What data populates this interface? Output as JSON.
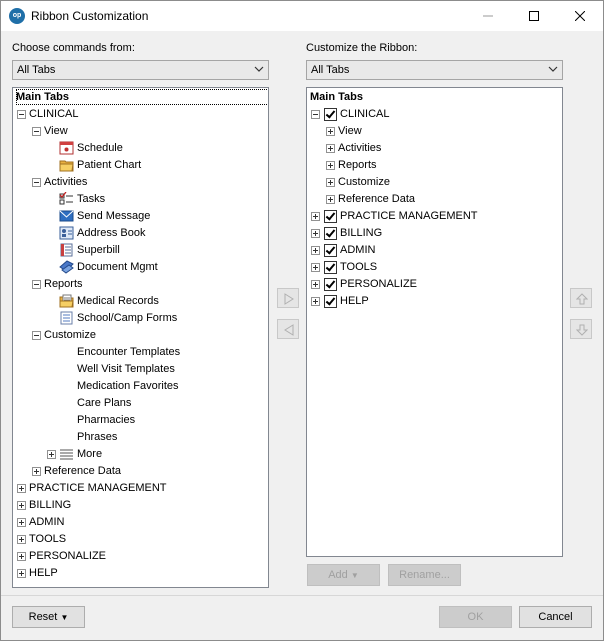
{
  "window": {
    "title": "Ribbon Customization",
    "app_icon": "op"
  },
  "left": {
    "label": "Choose commands from:",
    "combo_value": "All Tabs",
    "items": [
      {
        "label": "Main Tabs"
      },
      {
        "label": "CLINICAL"
      },
      {
        "label": "View"
      },
      {
        "label": "Schedule"
      },
      {
        "label": "Patient Chart"
      },
      {
        "label": "Activities"
      },
      {
        "label": "Tasks"
      },
      {
        "label": "Send Message"
      },
      {
        "label": "Address Book"
      },
      {
        "label": "Superbill"
      },
      {
        "label": "Document Mgmt"
      },
      {
        "label": "Reports"
      },
      {
        "label": "Medical Records"
      },
      {
        "label": "School/Camp Forms"
      },
      {
        "label": "Customize"
      },
      {
        "label": "Encounter Templates"
      },
      {
        "label": "Well Visit Templates"
      },
      {
        "label": "Medication Favorites"
      },
      {
        "label": "Care Plans"
      },
      {
        "label": "Pharmacies"
      },
      {
        "label": "Phrases"
      },
      {
        "label": "More"
      },
      {
        "label": "Reference Data"
      },
      {
        "label": "PRACTICE MANAGEMENT"
      },
      {
        "label": "BILLING"
      },
      {
        "label": "ADMIN"
      },
      {
        "label": "TOOLS"
      },
      {
        "label": "PERSONALIZE"
      },
      {
        "label": "HELP"
      }
    ]
  },
  "right": {
    "label": "Customize the Ribbon:",
    "combo_value": "All Tabs",
    "items": [
      {
        "label": "Main Tabs"
      },
      {
        "label": "CLINICAL"
      },
      {
        "label": "View"
      },
      {
        "label": "Activities"
      },
      {
        "label": "Reports"
      },
      {
        "label": "Customize"
      },
      {
        "label": "Reference Data"
      },
      {
        "label": "PRACTICE MANAGEMENT"
      },
      {
        "label": "BILLING"
      },
      {
        "label": "ADMIN"
      },
      {
        "label": "TOOLS"
      },
      {
        "label": "PERSONALIZE"
      },
      {
        "label": "HELP"
      }
    ],
    "add_label": "Add",
    "rename_label": "Rename..."
  },
  "footer": {
    "reset_label": "Reset",
    "ok_label": "OK",
    "cancel_label": "Cancel"
  }
}
